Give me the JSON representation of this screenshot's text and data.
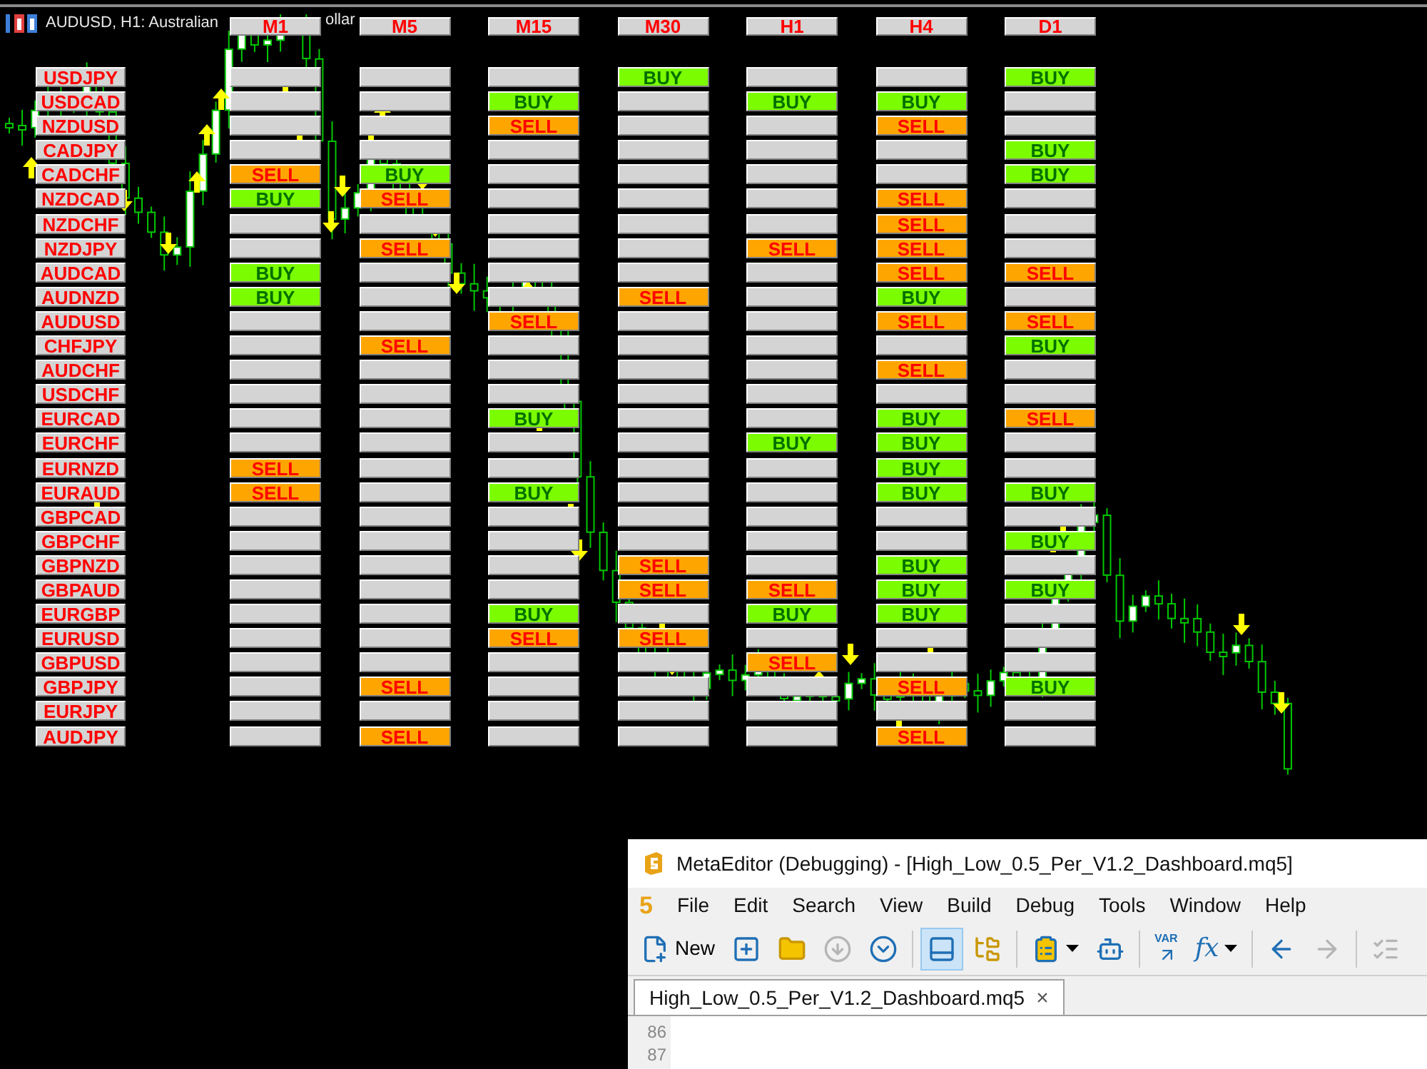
{
  "chart": {
    "title": "AUDUSD, H1:  Australian",
    "title_tail": "ollar"
  },
  "dashboard": {
    "timeframes": [
      "M1",
      "M5",
      "M15",
      "M30",
      "H1",
      "H4",
      "D1"
    ],
    "rows": [
      {
        "pair": "USDJPY",
        "signals": [
          {
            "kind": "none"
          },
          {
            "kind": "none"
          },
          {
            "kind": "none"
          },
          {
            "kind": "buy",
            "text": "BUY"
          },
          {
            "kind": "none"
          },
          {
            "kind": "none"
          },
          {
            "kind": "buy",
            "text": "BUY"
          }
        ]
      },
      {
        "pair": "USDCAD",
        "signals": [
          {
            "kind": "none"
          },
          {
            "kind": "none"
          },
          {
            "kind": "buy",
            "text": "BUY"
          },
          {
            "kind": "none"
          },
          {
            "kind": "buy",
            "text": "BUY"
          },
          {
            "kind": "buy",
            "text": "BUY"
          },
          {
            "kind": "none"
          }
        ]
      },
      {
        "pair": "NZDUSD",
        "signals": [
          {
            "kind": "none"
          },
          {
            "kind": "none"
          },
          {
            "kind": "sell",
            "text": "SELL"
          },
          {
            "kind": "none"
          },
          {
            "kind": "none"
          },
          {
            "kind": "sell",
            "text": "SELL"
          },
          {
            "kind": "none"
          }
        ]
      },
      {
        "pair": "CADJPY",
        "signals": [
          {
            "kind": "none"
          },
          {
            "kind": "none"
          },
          {
            "kind": "none"
          },
          {
            "kind": "none"
          },
          {
            "kind": "none"
          },
          {
            "kind": "none"
          },
          {
            "kind": "buy",
            "text": "BUY"
          }
        ]
      },
      {
        "pair": "CADCHF",
        "signals": [
          {
            "kind": "sell",
            "text": "SELL"
          },
          {
            "kind": "buy",
            "text": "BUY"
          },
          {
            "kind": "none"
          },
          {
            "kind": "none"
          },
          {
            "kind": "none"
          },
          {
            "kind": "none"
          },
          {
            "kind": "buy",
            "text": "BUY"
          }
        ]
      },
      {
        "pair": "NZDCAD",
        "signals": [
          {
            "kind": "buy",
            "text": "BUY"
          },
          {
            "kind": "sell",
            "text": "SELL"
          },
          {
            "kind": "none"
          },
          {
            "kind": "none"
          },
          {
            "kind": "none"
          },
          {
            "kind": "sell",
            "text": "SELL"
          },
          {
            "kind": "none"
          }
        ]
      },
      {
        "pair": "NZDCHF",
        "signals": [
          {
            "kind": "none"
          },
          {
            "kind": "none"
          },
          {
            "kind": "none"
          },
          {
            "kind": "none"
          },
          {
            "kind": "none"
          },
          {
            "kind": "sell",
            "text": "SELL"
          },
          {
            "kind": "none"
          }
        ]
      },
      {
        "pair": "NZDJPY",
        "signals": [
          {
            "kind": "none"
          },
          {
            "kind": "sell",
            "text": "SELL"
          },
          {
            "kind": "none"
          },
          {
            "kind": "none"
          },
          {
            "kind": "sell",
            "text": "SELL"
          },
          {
            "kind": "sell",
            "text": "SELL"
          },
          {
            "kind": "none"
          }
        ]
      },
      {
        "pair": "AUDCAD",
        "signals": [
          {
            "kind": "buy",
            "text": "BUY"
          },
          {
            "kind": "none"
          },
          {
            "kind": "none"
          },
          {
            "kind": "none"
          },
          {
            "kind": "none"
          },
          {
            "kind": "sell",
            "text": "SELL"
          },
          {
            "kind": "sell",
            "text": "SELL"
          }
        ]
      },
      {
        "pair": "AUDNZD",
        "signals": [
          {
            "kind": "buy",
            "text": "BUY"
          },
          {
            "kind": "none"
          },
          {
            "kind": "none"
          },
          {
            "kind": "sell",
            "text": "SELL"
          },
          {
            "kind": "none"
          },
          {
            "kind": "buy",
            "text": "BUY"
          },
          {
            "kind": "none"
          }
        ]
      },
      {
        "pair": "AUDUSD",
        "signals": [
          {
            "kind": "none"
          },
          {
            "kind": "none"
          },
          {
            "kind": "sell",
            "text": "SELL"
          },
          {
            "kind": "none"
          },
          {
            "kind": "none"
          },
          {
            "kind": "sell",
            "text": "SELL"
          },
          {
            "kind": "sell",
            "text": "SELL"
          }
        ]
      },
      {
        "pair": "CHFJPY",
        "signals": [
          {
            "kind": "none"
          },
          {
            "kind": "sell",
            "text": "SELL"
          },
          {
            "kind": "none"
          },
          {
            "kind": "none"
          },
          {
            "kind": "none"
          },
          {
            "kind": "none"
          },
          {
            "kind": "buy",
            "text": "BUY"
          }
        ]
      },
      {
        "pair": "AUDCHF",
        "signals": [
          {
            "kind": "none"
          },
          {
            "kind": "none"
          },
          {
            "kind": "none"
          },
          {
            "kind": "none"
          },
          {
            "kind": "none"
          },
          {
            "kind": "sell",
            "text": "SELL"
          },
          {
            "kind": "none"
          }
        ]
      },
      {
        "pair": "USDCHF",
        "signals": [
          {
            "kind": "none"
          },
          {
            "kind": "none"
          },
          {
            "kind": "none"
          },
          {
            "kind": "none"
          },
          {
            "kind": "none"
          },
          {
            "kind": "none"
          },
          {
            "kind": "none"
          }
        ]
      },
      {
        "pair": "EURCAD",
        "signals": [
          {
            "kind": "none"
          },
          {
            "kind": "none"
          },
          {
            "kind": "buy",
            "text": "BUY"
          },
          {
            "kind": "none"
          },
          {
            "kind": "none"
          },
          {
            "kind": "buy",
            "text": "BUY"
          },
          {
            "kind": "sell",
            "text": "SELL"
          }
        ]
      },
      {
        "pair": "EURCHF",
        "signals": [
          {
            "kind": "none"
          },
          {
            "kind": "none"
          },
          {
            "kind": "none"
          },
          {
            "kind": "none"
          },
          {
            "kind": "buy",
            "text": "BUY"
          },
          {
            "kind": "buy",
            "text": "BUY"
          },
          {
            "kind": "none"
          }
        ]
      },
      {
        "pair": "EURNZD",
        "signals": [
          {
            "kind": "sell",
            "text": "SELL"
          },
          {
            "kind": "none"
          },
          {
            "kind": "none"
          },
          {
            "kind": "none"
          },
          {
            "kind": "none"
          },
          {
            "kind": "buy",
            "text": "BUY"
          },
          {
            "kind": "none"
          }
        ]
      },
      {
        "pair": "EURAUD",
        "signals": [
          {
            "kind": "sell",
            "text": "SELL"
          },
          {
            "kind": "none"
          },
          {
            "kind": "buy",
            "text": "BUY"
          },
          {
            "kind": "none"
          },
          {
            "kind": "none"
          },
          {
            "kind": "buy",
            "text": "BUY"
          },
          {
            "kind": "buy",
            "text": "BUY"
          }
        ]
      },
      {
        "pair": "GBPCAD",
        "signals": [
          {
            "kind": "none"
          },
          {
            "kind": "none"
          },
          {
            "kind": "none"
          },
          {
            "kind": "none"
          },
          {
            "kind": "none"
          },
          {
            "kind": "none"
          },
          {
            "kind": "none"
          }
        ]
      },
      {
        "pair": "GBPCHF",
        "signals": [
          {
            "kind": "none"
          },
          {
            "kind": "none"
          },
          {
            "kind": "none"
          },
          {
            "kind": "none"
          },
          {
            "kind": "none"
          },
          {
            "kind": "none"
          },
          {
            "kind": "buy",
            "text": "BUY"
          }
        ]
      },
      {
        "pair": "GBPNZD",
        "signals": [
          {
            "kind": "none"
          },
          {
            "kind": "none"
          },
          {
            "kind": "none"
          },
          {
            "kind": "sell",
            "text": "SELL"
          },
          {
            "kind": "none"
          },
          {
            "kind": "buy",
            "text": "BUY"
          },
          {
            "kind": "none"
          }
        ]
      },
      {
        "pair": "GBPAUD",
        "signals": [
          {
            "kind": "none"
          },
          {
            "kind": "none"
          },
          {
            "kind": "none"
          },
          {
            "kind": "sell",
            "text": "SELL"
          },
          {
            "kind": "sell",
            "text": "SELL"
          },
          {
            "kind": "buy",
            "text": "BUY"
          },
          {
            "kind": "buy",
            "text": "BUY"
          }
        ]
      },
      {
        "pair": "EURGBP",
        "signals": [
          {
            "kind": "none"
          },
          {
            "kind": "none"
          },
          {
            "kind": "buy",
            "text": "BUY"
          },
          {
            "kind": "none"
          },
          {
            "kind": "buy",
            "text": "BUY"
          },
          {
            "kind": "buy",
            "text": "BUY"
          },
          {
            "kind": "none"
          }
        ]
      },
      {
        "pair": "EURUSD",
        "signals": [
          {
            "kind": "none"
          },
          {
            "kind": "none"
          },
          {
            "kind": "sell",
            "text": "SELL"
          },
          {
            "kind": "sell",
            "text": "SELL"
          },
          {
            "kind": "none"
          },
          {
            "kind": "none"
          },
          {
            "kind": "none"
          }
        ]
      },
      {
        "pair": "GBPUSD",
        "signals": [
          {
            "kind": "none"
          },
          {
            "kind": "none"
          },
          {
            "kind": "none"
          },
          {
            "kind": "none"
          },
          {
            "kind": "sell",
            "text": "SELL"
          },
          {
            "kind": "none"
          },
          {
            "kind": "none"
          }
        ]
      },
      {
        "pair": "GBPJPY",
        "signals": [
          {
            "kind": "none"
          },
          {
            "kind": "sell",
            "text": "SELL"
          },
          {
            "kind": "none"
          },
          {
            "kind": "none"
          },
          {
            "kind": "none"
          },
          {
            "kind": "sell",
            "text": "SELL"
          },
          {
            "kind": "buy",
            "text": "BUY"
          }
        ]
      },
      {
        "pair": "EURJPY",
        "signals": [
          {
            "kind": "none"
          },
          {
            "kind": "none"
          },
          {
            "kind": "none"
          },
          {
            "kind": "none"
          },
          {
            "kind": "none"
          },
          {
            "kind": "none"
          },
          {
            "kind": "none"
          }
        ]
      },
      {
        "pair": "AUDJPY",
        "signals": [
          {
            "kind": "none"
          },
          {
            "kind": "sell",
            "text": "SELL"
          },
          {
            "kind": "none"
          },
          {
            "kind": "none"
          },
          {
            "kind": "none"
          },
          {
            "kind": "sell",
            "text": "SELL"
          },
          {
            "kind": "none"
          }
        ]
      }
    ]
  },
  "editor": {
    "title": "MetaEditor (Debugging) - [High_Low_0.5_Per_V1.2_Dashboard.mq5]",
    "logo": "5",
    "menu": [
      "File",
      "Edit",
      "Search",
      "View",
      "Build",
      "Debug",
      "Tools",
      "Window",
      "Help"
    ],
    "toolbar": [
      {
        "kind": "new",
        "label": "New",
        "selected": false,
        "disabled": false
      },
      {
        "kind": "new-window",
        "selected": false,
        "disabled": false
      },
      {
        "kind": "open",
        "selected": false,
        "disabled": false
      },
      {
        "kind": "download",
        "selected": false,
        "disabled": true
      },
      {
        "kind": "download-all",
        "selected": false,
        "disabled": false
      },
      {
        "kind": "separator"
      },
      {
        "kind": "layout",
        "selected": true,
        "disabled": false
      },
      {
        "kind": "folder-tree",
        "selected": false,
        "disabled": false
      },
      {
        "kind": "separator"
      },
      {
        "kind": "clipboard",
        "dropdown": true,
        "selected": false,
        "disabled": false
      },
      {
        "kind": "robot",
        "selected": false,
        "disabled": false
      },
      {
        "kind": "separator"
      },
      {
        "kind": "var",
        "label": "VAR",
        "selected": false,
        "disabled": false
      },
      {
        "kind": "fx",
        "label": "fx",
        "dropdown": true,
        "selected": false,
        "disabled": false
      },
      {
        "kind": "separator"
      },
      {
        "kind": "back",
        "selected": false,
        "disabled": false
      },
      {
        "kind": "forward",
        "selected": false,
        "disabled": true
      },
      {
        "kind": "separator"
      },
      {
        "kind": "list",
        "selected": false,
        "disabled": true
      }
    ],
    "tabs": [
      {
        "label": "High_Low_0.5_Per_V1.2_Dashboard.mq5",
        "close": "×",
        "selected": true
      }
    ],
    "line_numbers": [
      "86",
      "87"
    ]
  }
}
